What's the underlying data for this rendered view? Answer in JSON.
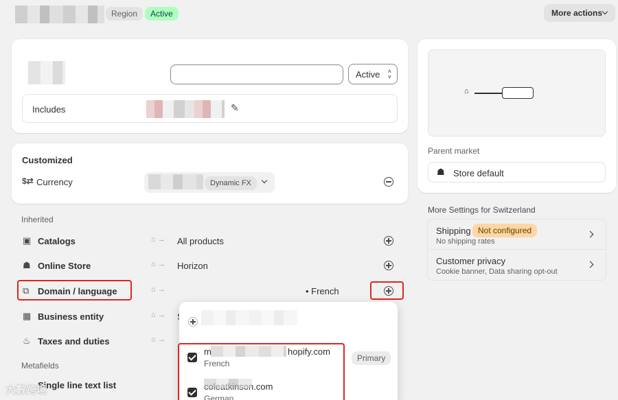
{
  "header": {
    "badge_region": "Region",
    "badge_active": "Active",
    "more_actions": "More actions"
  },
  "top_card": {
    "status_select": "Active",
    "includes_label": "Includes"
  },
  "customized": {
    "heading": "Customized",
    "currency_label": "Currency",
    "dynamic_fx": "Dynamic FX"
  },
  "inherited": {
    "heading": "Inherited",
    "rows": [
      {
        "label": "Catalogs",
        "value": "All products"
      },
      {
        "label": "Online Store",
        "value": "Horizon"
      },
      {
        "label": "Domain / language",
        "value": "• French"
      },
      {
        "label": "Business entity",
        "value": "S"
      },
      {
        "label": "Taxes and duties",
        "value": ""
      }
    ]
  },
  "metafields": {
    "heading": "Metafields",
    "row_label": "Single line text list"
  },
  "dropdown": {
    "items": [
      {
        "domain": "m",
        "domain_suffix": "hopify.com",
        "language": "French",
        "badge": "Primary"
      },
      {
        "domain": "coleatkinson.com",
        "language": "German"
      }
    ]
  },
  "right": {
    "parent_market_label": "Parent market",
    "store_default": "Store default",
    "more_settings_title": "More Settings for Switzerland",
    "shipping_title": "Shipping",
    "shipping_badge": "Not configured",
    "shipping_sub": "No shipping rates",
    "privacy_title": "Customer privacy",
    "privacy_sub": "Cookie banner, Data sharing opt-out"
  },
  "watermark": "大數跨境",
  "colors": {
    "accent_red": "#e0251c",
    "active_badge_bg": "#affebf",
    "warning_badge_bg": "#ffd6a4"
  }
}
